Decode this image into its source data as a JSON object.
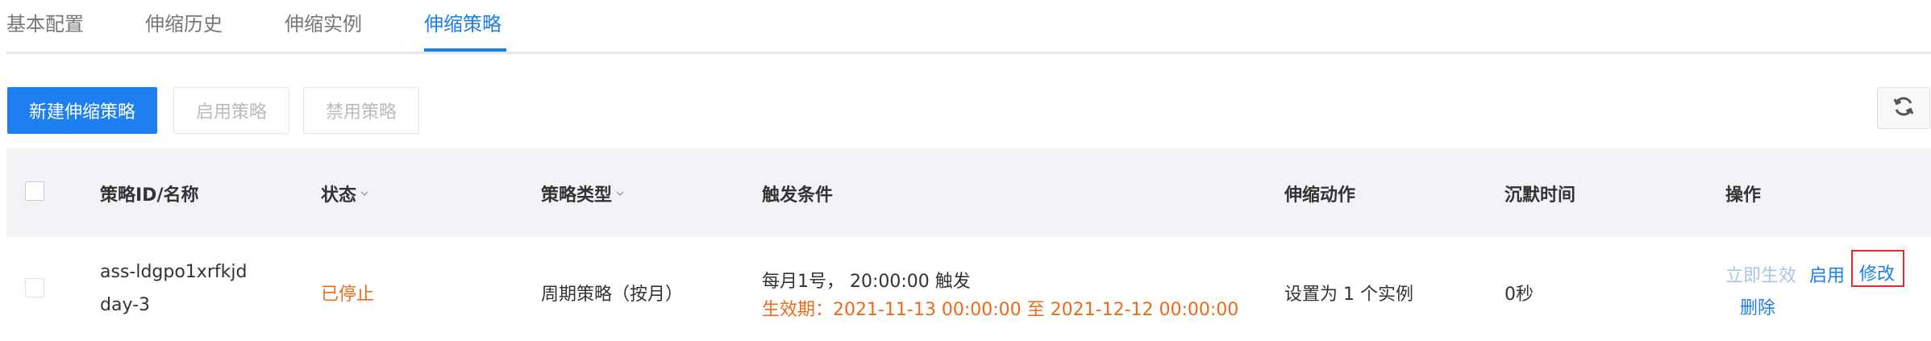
{
  "tabs": [
    {
      "label": "基本配置",
      "active": false
    },
    {
      "label": "伸缩历史",
      "active": false
    },
    {
      "label": "伸缩实例",
      "active": false
    },
    {
      "label": "伸缩策略",
      "active": true
    }
  ],
  "toolbar": {
    "create_label": "新建伸缩策略",
    "enable_label": "启用策略",
    "disable_label": "禁用策略",
    "refresh_icon": "refresh-icon"
  },
  "table": {
    "columns": {
      "id_name": "策略ID/名称",
      "status": "状态",
      "type": "策略类型",
      "trigger": "触发条件",
      "action": "伸缩动作",
      "cooldown": "沉默时间",
      "ops": "操作"
    },
    "rows": [
      {
        "id": "ass-ldgpo1xrfkjd",
        "name": "day-3",
        "status": "已停止",
        "type": "周期策略（按月）",
        "trigger_line1": "每月1号， 20:00:00 触发",
        "trigger_line2": "生效期：2021-11-13 00:00:00 至 2021-12-12 00:00:00",
        "action": "设置为 1 个实例",
        "cooldown": "0秒",
        "ops": {
          "execute_now": "立即生效",
          "enable": "启用",
          "modify": "修改",
          "delete": "删除"
        }
      }
    ]
  },
  "colors": {
    "accent": "#1f7ee6",
    "primary_button": "#1d7ff0",
    "status_stopped": "#ee6a1a",
    "highlight_box": "#e22a2a"
  }
}
